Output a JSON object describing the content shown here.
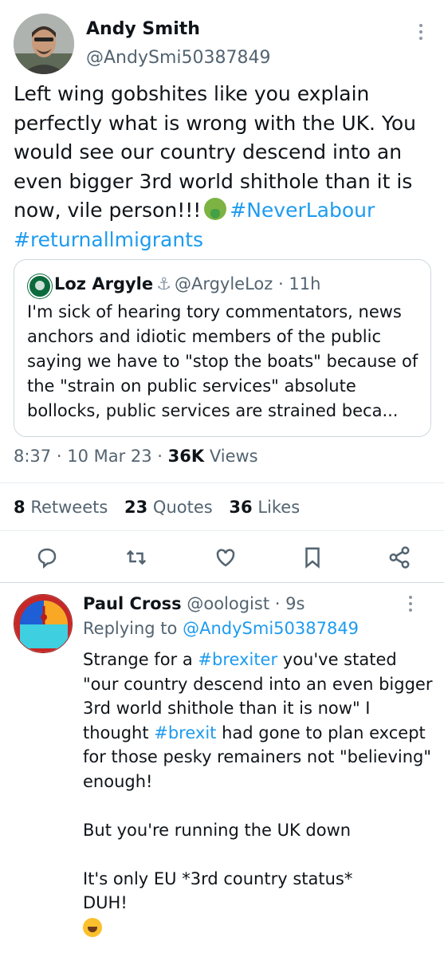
{
  "main_tweet": {
    "author_name": "Andy Smith",
    "handle": "@AndySmi50387849",
    "text_plain": "Left wing gobshites like you explain perfectly what is wrong with the UK. You would see our country descend into an even bigger 3rd world shithole than it is now, vile person!!!",
    "hashtags": [
      "#NeverLabour",
      "#returnallmigrants"
    ],
    "time": "8:37",
    "date": "10 Mar 23",
    "views_count": "36K",
    "views_label": "Views",
    "retweets_count": "8",
    "retweets_label": "Retweets",
    "quotes_count": "23",
    "quotes_label": "Quotes",
    "likes_count": "36",
    "likes_label": "Likes"
  },
  "quoted_tweet": {
    "author_name": "Loz Argyle",
    "handle": "@ArgyleLoz",
    "time_ago": "11h",
    "text": "I'm sick of hearing tory commentators, news anchors and idiotic members of the public saying we have to \"stop the boats\" because of the \"strain on public services\" absolute bollocks, public services are strained beca..."
  },
  "reply": {
    "author_name": "Paul Cross",
    "handle": "@oologist",
    "time_ago": "9s",
    "replying_label": "Replying to",
    "replying_to": "@AndySmi50387849",
    "text_part1": "Strange for a ",
    "hashtag1": "#brexiter",
    "text_part2": " you've stated \"our country descend into an even bigger 3rd world shithole than it is now\" I thought ",
    "hashtag2": "#brexit",
    "text_part3": " had gone to plan except for those pesky remainers not \"believing\" enough!\n\nBut you're running the UK down\n\nIt's only EU *3rd country status*\nDUH!"
  },
  "colors": {
    "link": "#1d9bf0",
    "secondary_text": "#536471",
    "divider": "#e6ecf0"
  },
  "icons": [
    "more-vertical-icon",
    "anchor-icon",
    "reply-icon",
    "retweet-icon",
    "like-icon",
    "bookmark-icon",
    "share-icon",
    "vomit-emoji",
    "laughing-emoji"
  ]
}
